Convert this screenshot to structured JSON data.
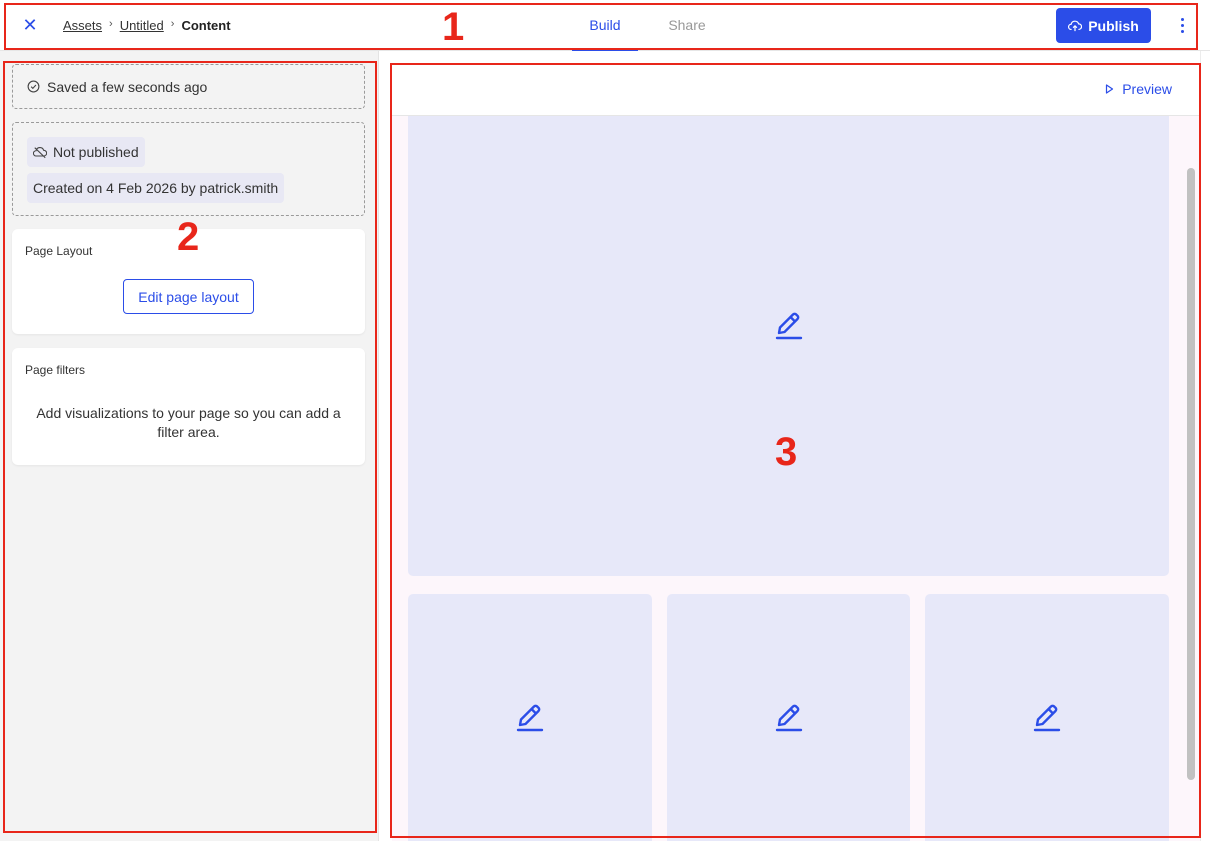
{
  "topbar": {
    "breadcrumb": {
      "assets": "Assets",
      "untitled": "Untitled",
      "current": "Content"
    },
    "tabs": {
      "build": "Build",
      "share": "Share"
    },
    "publish_label": "Publish"
  },
  "sidebar": {
    "saved_text": "Saved a few seconds ago",
    "status_text": "Not published",
    "created_text": "Created on 4 Feb 2026 by patrick.smith",
    "page_layout": {
      "title": "Page Layout",
      "button": "Edit page layout"
    },
    "page_filters": {
      "title": "Page filters",
      "message": "Add visualizations to your page so you can add a filter area."
    }
  },
  "canvas": {
    "preview_label": "Preview"
  },
  "annotations": {
    "one": "1",
    "two": "2",
    "three": "3"
  },
  "colors": {
    "accent": "#2b4de8",
    "annotation": "#e8261a",
    "tile": "#e7e8f9",
    "panel": "#f3f3f3"
  },
  "icons": [
    "close-icon",
    "chevron-right-icon",
    "cloud-upload-icon",
    "more-vertical-icon",
    "check-circle-icon",
    "cloud-off-icon",
    "play-icon",
    "pencil-icon"
  ]
}
